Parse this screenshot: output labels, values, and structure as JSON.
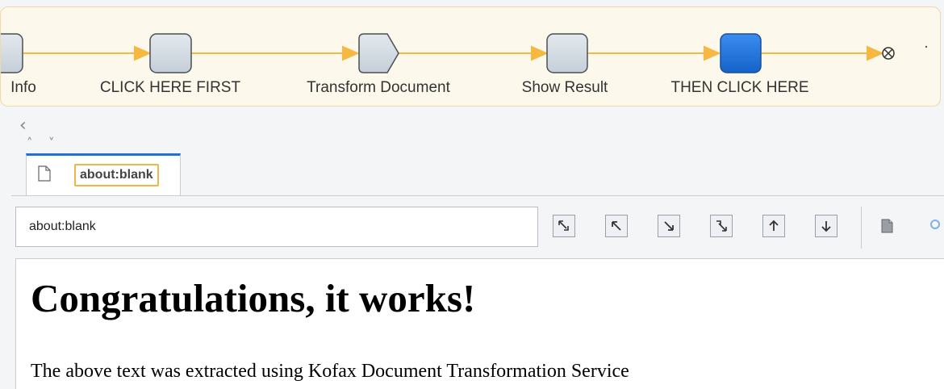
{
  "workflow": {
    "steps": [
      {
        "label": "Info",
        "shape": "rounded",
        "active": false,
        "partial": true
      },
      {
        "label": "CLICK HERE FIRST",
        "shape": "rounded",
        "active": false
      },
      {
        "label": "Transform Document",
        "shape": "pentagon",
        "active": false
      },
      {
        "label": "Show Result",
        "shape": "rounded",
        "active": false
      },
      {
        "label": "THEN CLICK HERE",
        "shape": "rounded",
        "active": true
      }
    ],
    "end_icon": "end-circle-x-icon"
  },
  "nav": {
    "back_glyph": "‹",
    "up_glyph": "˄",
    "down_glyph": "˅"
  },
  "tab": {
    "title": "about:blank",
    "icon": "page-icon"
  },
  "address": {
    "value": "about:blank"
  },
  "toolbar": {
    "buttons": [
      "select-parent-icon",
      "arrow-up-left-icon",
      "arrow-down-right-icon",
      "select-child-icon",
      "arrow-up-icon",
      "arrow-down-icon",
      "document-icon",
      "search-icon"
    ]
  },
  "content": {
    "heading": "Congratulations, it works!",
    "paragraph": "The above text was extracted using Kofax Document Transformation Service"
  },
  "colors": {
    "connector": "#f5b942",
    "step_fill": "#d3dbe2",
    "step_active": "#2178e0",
    "tab_accent": "#1f73d8",
    "focus_outline": "#f4b24a"
  }
}
